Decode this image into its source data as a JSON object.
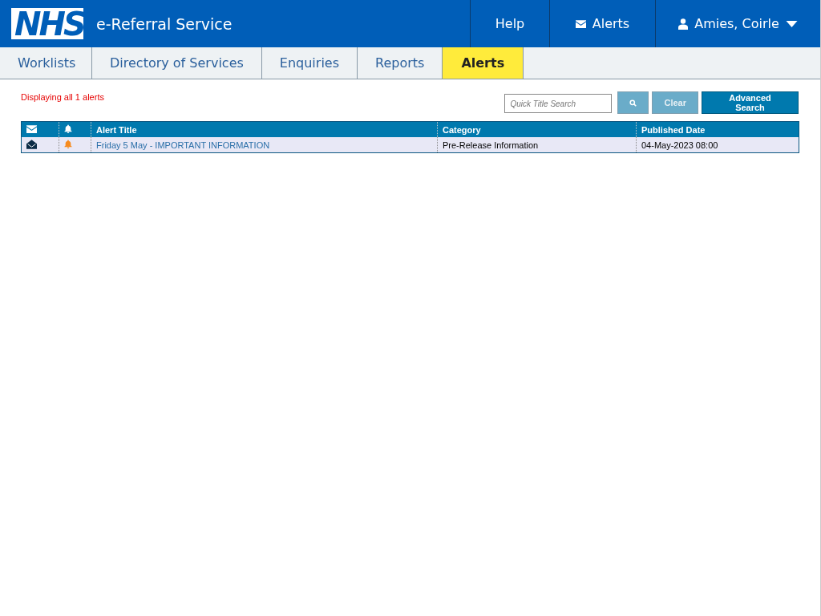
{
  "header": {
    "logo": "NHS",
    "service": "e-Referral Service",
    "links": [
      {
        "kind": "help",
        "label": "Help"
      },
      {
        "kind": "alerts",
        "label": "Alerts"
      },
      {
        "kind": "user",
        "label": "Amies, Coirle"
      }
    ]
  },
  "tabs": [
    {
      "label": "Worklists",
      "selected": false
    },
    {
      "label": "Directory of Services",
      "selected": false
    },
    {
      "label": "Enquiries",
      "selected": false
    },
    {
      "label": "Reports",
      "selected": false
    },
    {
      "label": "Alerts",
      "selected": true
    }
  ],
  "status": "Displaying all 1 alerts",
  "search": {
    "placeholder": "Quick Title Search",
    "search_disabled": true,
    "clear": "Clear",
    "clear_disabled": true,
    "advanced": "Advanced Search"
  },
  "table": {
    "columns": [
      "Alert Title",
      "Category",
      "Published Date"
    ],
    "rows": [
      {
        "read": true,
        "title": "Friday 5 May - IMPORTANT INFORMATION",
        "category": "Pre-Release Information",
        "published": "04-May-2023 08:00"
      }
    ]
  }
}
